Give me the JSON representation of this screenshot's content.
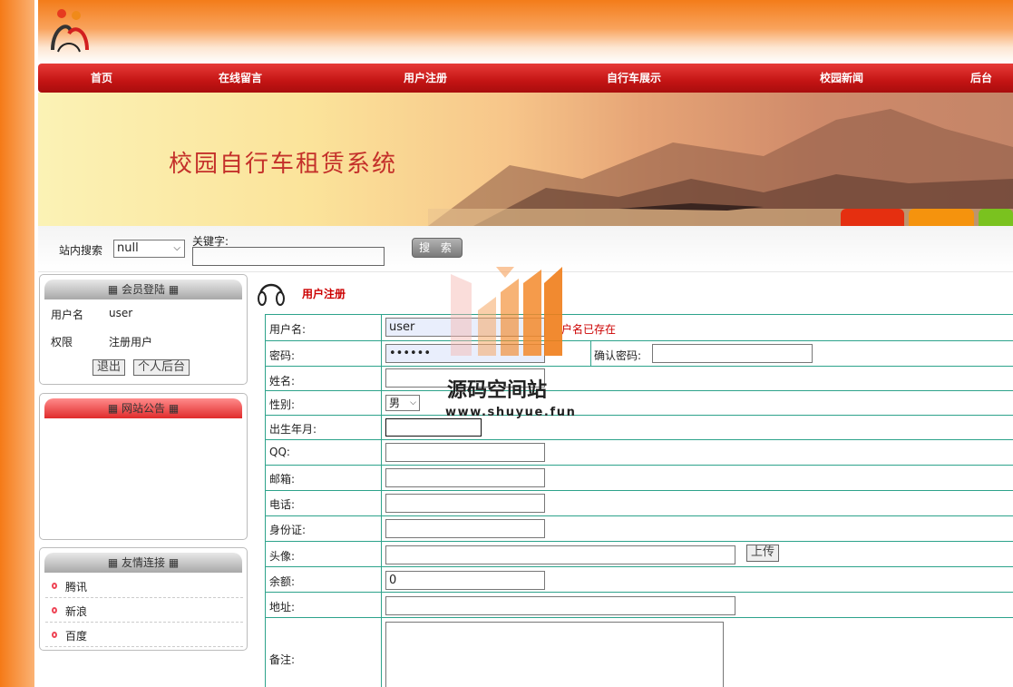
{
  "nav": {
    "items": [
      {
        "label": "首页"
      },
      {
        "label": "在线留言"
      },
      {
        "label": "用户注册"
      },
      {
        "label": "自行车展示"
      },
      {
        "label": "校园新闻"
      },
      {
        "label": "后台"
      }
    ]
  },
  "banner": {
    "title": "校园自行车租赁系统"
  },
  "search": {
    "label": "站内搜索",
    "select_value": "null",
    "keyword_label": "关键字:",
    "button": "搜 索"
  },
  "login_box": {
    "title": "会员登陆",
    "username_label": "用户名",
    "username_value": "user",
    "role_label": "权限",
    "role_value": "注册用户",
    "logout_button": "退出",
    "admin_button": "个人后台"
  },
  "notice_box": {
    "title": "网站公告"
  },
  "links_box": {
    "title": "友情连接",
    "items": [
      {
        "label": "腾讯"
      },
      {
        "label": "新浪"
      },
      {
        "label": "百度"
      }
    ]
  },
  "main": {
    "title": "用户注册",
    "form": {
      "username_label": "用户名:",
      "username_value": "user",
      "username_error": "户名已存在",
      "password_label": "密码:",
      "password_value": "••••••",
      "confirm_label": "确认密码:",
      "name_label": "姓名:",
      "gender_label": "性别:",
      "gender_value": "男",
      "birth_label": "出生年月:",
      "qq_label": "QQ:",
      "email_label": "邮箱:",
      "phone_label": "电话:",
      "idcard_label": "身份证:",
      "avatar_label": "头像:",
      "upload_button": "上传",
      "balance_label": "余额:",
      "balance_value": "0",
      "address_label": "地址:",
      "remark_label": "备注:"
    }
  },
  "watermark": {
    "title": "源码空间站",
    "url": "www.shuyue.fun"
  },
  "colors": {
    "nav_red": "#c41414",
    "accent_orange": "#f37c1a",
    "form_border": "#2da38b",
    "error_red": "#cc0000"
  }
}
